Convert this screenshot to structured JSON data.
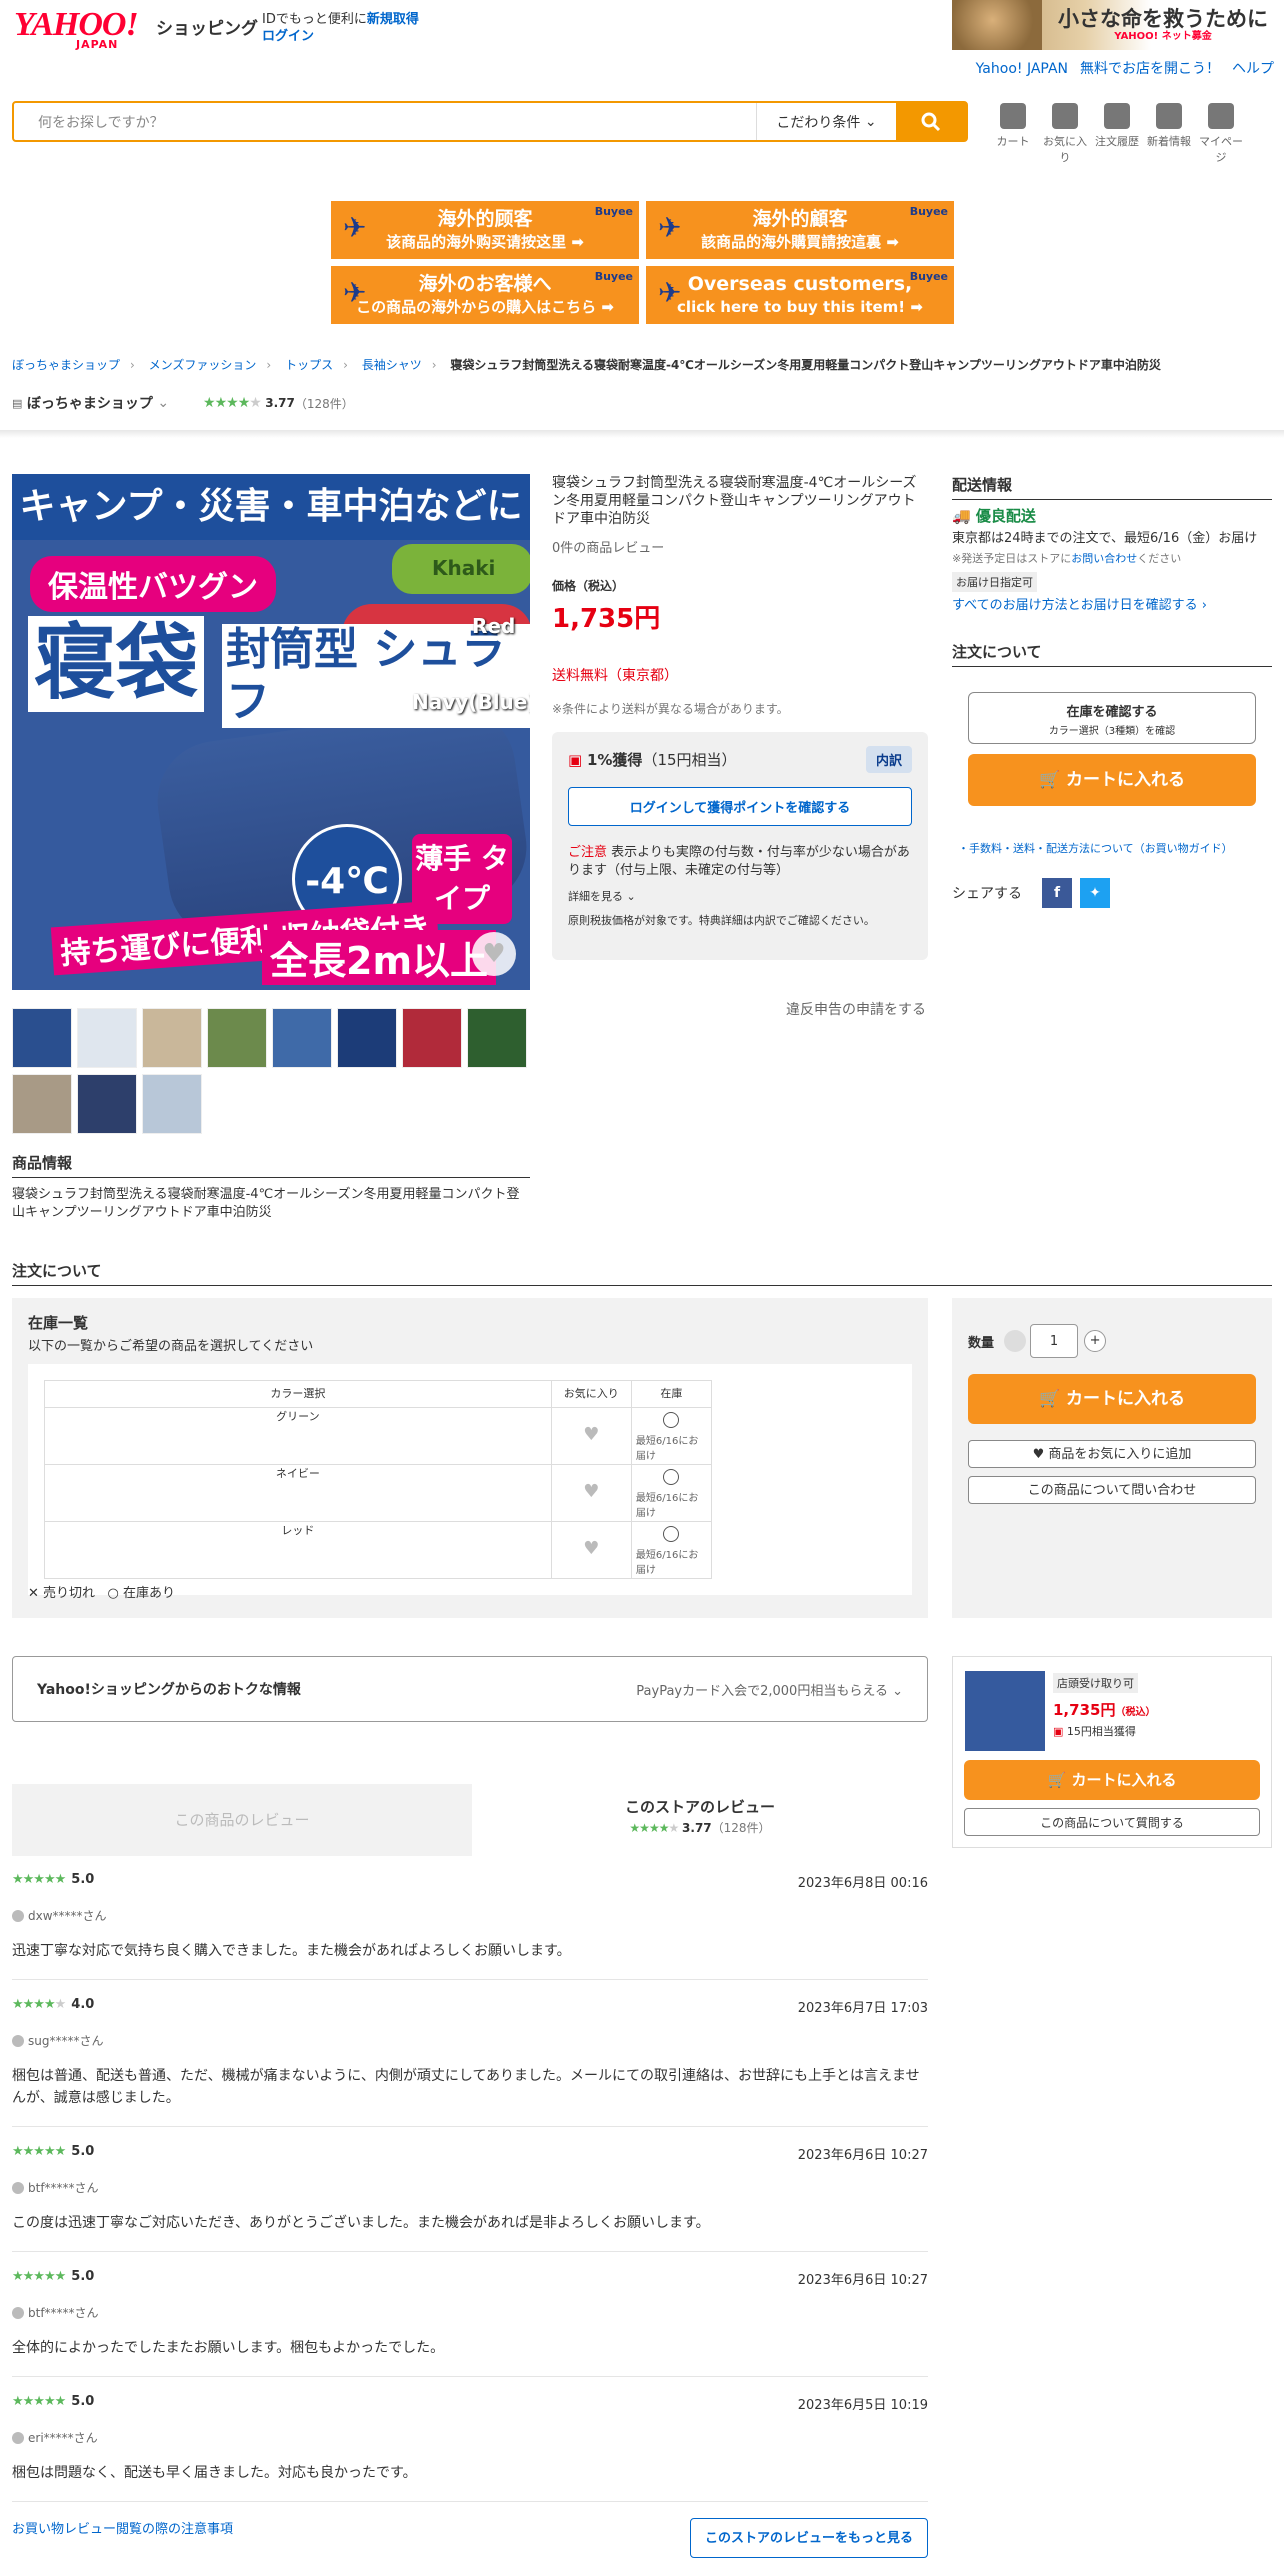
{
  "header": {
    "logo_main": "YAHOO!",
    "logo_sub": "JAPAN",
    "shopping": "ショッピング",
    "id_text": "IDでもっと便利に",
    "signup": "新規取得",
    "login": "ログイン",
    "ad_text": "小さな命を救うために",
    "ad_sub": "YAHOO! ネット募金",
    "links": [
      "Yahoo! JAPAN",
      "無料でお店を開こう！",
      "ヘルプ"
    ]
  },
  "search": {
    "placeholder": "何をお探しですか？",
    "condition": "こだわり条件",
    "search_icon": "search-icon"
  },
  "utilities": [
    {
      "label": "カート",
      "icon": "cart-icon"
    },
    {
      "label": "お気に入り",
      "icon": "heart-icon"
    },
    {
      "label": "注文履歴",
      "icon": "history-icon"
    },
    {
      "label": "新着情報",
      "icon": "bell-icon"
    },
    {
      "label": "マイページ",
      "icon": "user-icon"
    }
  ],
  "buyee": [
    {
      "l1": "海外的顾客",
      "l2": "该商品的海外购买请按这里 ➡"
    },
    {
      "l1": "海外的顧客",
      "l2": "該商品的海外購買請按這裏 ➡"
    },
    {
      "l1": "海外のお客様へ",
      "l2": "この商品の海外からの購入はこちら ➡"
    },
    {
      "l1": "Overseas customers,",
      "l2": "click here to buy this item! ➡"
    }
  ],
  "buyee_tag": "Buyee",
  "breadcrumb": [
    "ぼっちゃまショップ",
    "メンズファッション",
    "トップス",
    "長袖シャツ"
  ],
  "breadcrumb_current": "寝袋シュラフ封筒型洗える寝袋耐寒温度-4℃オールシーズン冬用夏用軽量コンパクト登山キャンプツーリングアウトドア車中泊防災",
  "store": {
    "name": "ぼっちゃまショップ",
    "rating": "3.77",
    "count": "（128件）"
  },
  "main_image": {
    "banner": "キャンプ・災害・車中泊などに",
    "tag": "保温性バツグン",
    "big": "寝袋",
    "kind": "封筒型 シュラフ",
    "green": "Khaki",
    "red": "Red",
    "navy": "Navy(Blue)",
    "temp": "-4℃",
    "thin": "薄手 タイプ",
    "carry": "持ち運びに便利 収納袋付き",
    "length": "全長2m以上"
  },
  "thumb_colors": [
    "#2a4f8f",
    "#dfe6ee",
    "#c9b79a",
    "#6c8a4c",
    "#3f6aa8",
    "#1c3c78",
    "#b12a3a",
    "#2e5f2f",
    "#a89a86",
    "#2d3f6b",
    "#b8c7d8"
  ],
  "product": {
    "title": "寝袋シュラフ封筒型洗える寝袋耐寒温度-4℃オールシーズン冬用夏用軽量コンパクト登山キャンプツーリングアウトドア車中泊防災",
    "reviews": "0件の商品レビュー",
    "price_label": "価格（税込）",
    "price": "1,735円",
    "shipping": "送料無料（東京都）",
    "shipping_note": "※条件により送料が異なる場合があります。"
  },
  "points": {
    "rate": "1%獲得",
    "approx": "（15円相当）",
    "badge": "内訳",
    "login_btn": "ログインして獲得ポイントを確認する",
    "notice_red": "ご注意",
    "notice": "表示よりも実際の付与数・付与率が少ない場合があります（付与上限、未確定の付与等）",
    "more": "詳細を見る",
    "note2": "原則税抜価格が対象です。特典詳細は内訳でご確認ください。"
  },
  "report": "違反申告の申請をする",
  "delivery": {
    "heading": "配送情報",
    "good": "優良配送",
    "text": "東京都は24時までの注文で、最短6/16（金）お届け",
    "note_prefix": "※発送予定日はストアに",
    "note_link": "お問い合わせ",
    "note_suffix": "ください",
    "tag": "お届け日指定可",
    "link": "すべてのお届け方法とお届け日を確認する ›"
  },
  "order": {
    "heading": "注文について",
    "stock_btn": "在庫を確認する",
    "stock_sub": "カラー選択（3種類）を確認",
    "cart": "カートに入れる",
    "guide": "・手数料・送料・配送方法について（お買い物ガイド）",
    "share": "シェアする"
  },
  "product_info": {
    "heading": "商品情報",
    "text": "寝袋シュラフ封筒型洗える寝袋耐寒温度-4℃オールシーズン冬用夏用軽量コンパクト登山キャンプツーリングアウトドア車中泊防災"
  },
  "order_section": "注文について",
  "stock_list": {
    "heading": "在庫一覧",
    "sub": "以下の一覧からご希望の商品を選択してください",
    "headers": [
      "カラー選択",
      "お気に入り",
      "在庫"
    ],
    "rows": [
      {
        "color": "グリーン",
        "note": "最短6/16にお届け"
      },
      {
        "color": "ネイビー",
        "note": "最短6/16にお届け"
      },
      {
        "color": "レッド",
        "note": "最短6/16にお届け"
      }
    ],
    "legend_sold": "売り切れ",
    "legend_avail": "在庫あり"
  },
  "qty": {
    "label": "数量",
    "value": "1",
    "plus": "+",
    "cart": "カートに入れる",
    "fav": "商品をお気に入りに追加",
    "ask": "この商品について問い合わせ"
  },
  "deals": {
    "title": "Yahoo!ショッピングからのおトクな情報",
    "right": "PayPayカード入会で2,000円相当もらえる"
  },
  "review_tabs": {
    "tab1": "この商品のレビュー",
    "tab2": "このストアのレビュー",
    "rating": "3.77",
    "count": "（128件）"
  },
  "reviews": [
    {
      "stars": 5,
      "score": "5.0",
      "date": "2023年6月8日 00:16",
      "user": "dxw*****さん",
      "text": "迅速丁寧な対応で気持ち良く購入できました。また機会があればよろしくお願いします。"
    },
    {
      "stars": 4,
      "score": "4.0",
      "date": "2023年6月7日 17:03",
      "user": "sug*****さん",
      "text": "梱包は普通、配送も普通、ただ、機械が痛まないように、内側が頑丈にしてありました。メールにての取引連絡は、お世辞にも上手とは言えませんが、誠意は感じました。"
    },
    {
      "stars": 5,
      "score": "5.0",
      "date": "2023年6月6日 10:27",
      "user": "btf*****さん",
      "text": "この度は迅速丁寧なご対応いただき、ありがとうございました。また機会があれば是非よろしくお願いします。"
    },
    {
      "stars": 5,
      "score": "5.0",
      "date": "2023年6月6日 10:27",
      "user": "btf*****さん",
      "text": "全体的によかったでしたまたお願いします。梱包もよかったでした。"
    },
    {
      "stars": 5,
      "score": "5.0",
      "date": "2023年6月5日 10:19",
      "user": "eri*****さん",
      "text": "梱包は問題なく、配送も早く届きました。対応も良かったです。"
    }
  ],
  "review_note": "お買い物レビュー閲覧の際の注意事項",
  "review_more": "このストアのレビューをもっと見る",
  "sticky": {
    "tag": "店頭受け取り可",
    "price": "1,735円",
    "tax": "（税込）",
    "points": "15円相当獲得",
    "cart": "カートに入れる",
    "ask": "この商品について質問する"
  },
  "colors": {
    "accent": "#f7921e",
    "price": "#e60012",
    "link": "#0066cc",
    "stars": "#5cb85c"
  }
}
